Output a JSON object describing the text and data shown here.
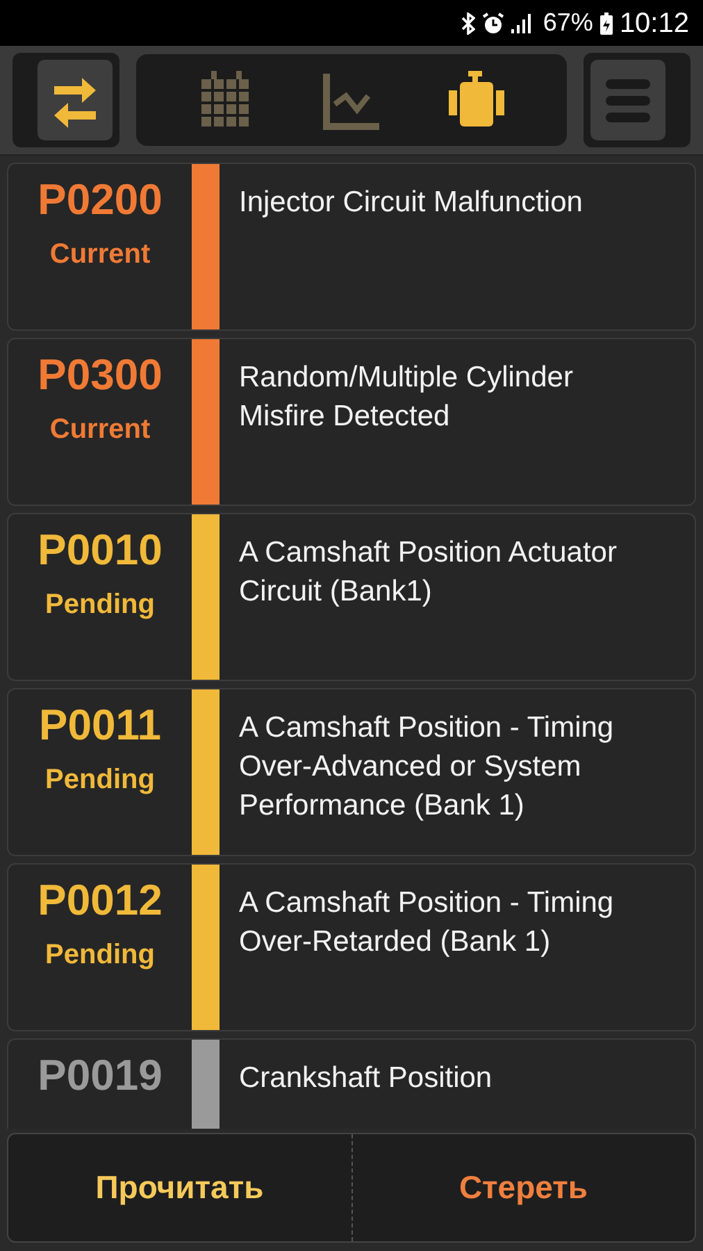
{
  "status_bar": {
    "battery": "67%",
    "time": "10:12"
  },
  "toolbar": {
    "tabs": [
      {
        "kind": "calendar",
        "selected": false
      },
      {
        "kind": "chart",
        "selected": false
      },
      {
        "kind": "engine",
        "selected": true
      }
    ]
  },
  "codes": [
    {
      "code": "P0200",
      "status": "Current",
      "description": "Injector Circuit Malfunction",
      "color": "#f07a35"
    },
    {
      "code": "P0300",
      "status": "Current",
      "description": "Random/Multiple Cylinder Misfire Detected",
      "color": "#f07a35"
    },
    {
      "code": "P0010",
      "status": "Pending",
      "description": "A Camshaft Position Actuator Circuit (Bank1)",
      "color": "#f0b93a"
    },
    {
      "code": "P0011",
      "status": "Pending",
      "description": "A Camshaft Position - Timing Over-Advanced or System Performance (Bank 1)",
      "color": "#f0b93a"
    },
    {
      "code": "P0012",
      "status": "Pending",
      "description": "A Camshaft Position - Timing Over-Retarded (Bank 1)",
      "color": "#f0b93a"
    },
    {
      "code": "P0019",
      "description": "Crankshaft Position",
      "color": "#9a9a9a"
    }
  ],
  "buttons": [
    {
      "label": "Прочитать",
      "kind": "read"
    },
    {
      "label": "Стереть",
      "kind": "erase"
    }
  ]
}
